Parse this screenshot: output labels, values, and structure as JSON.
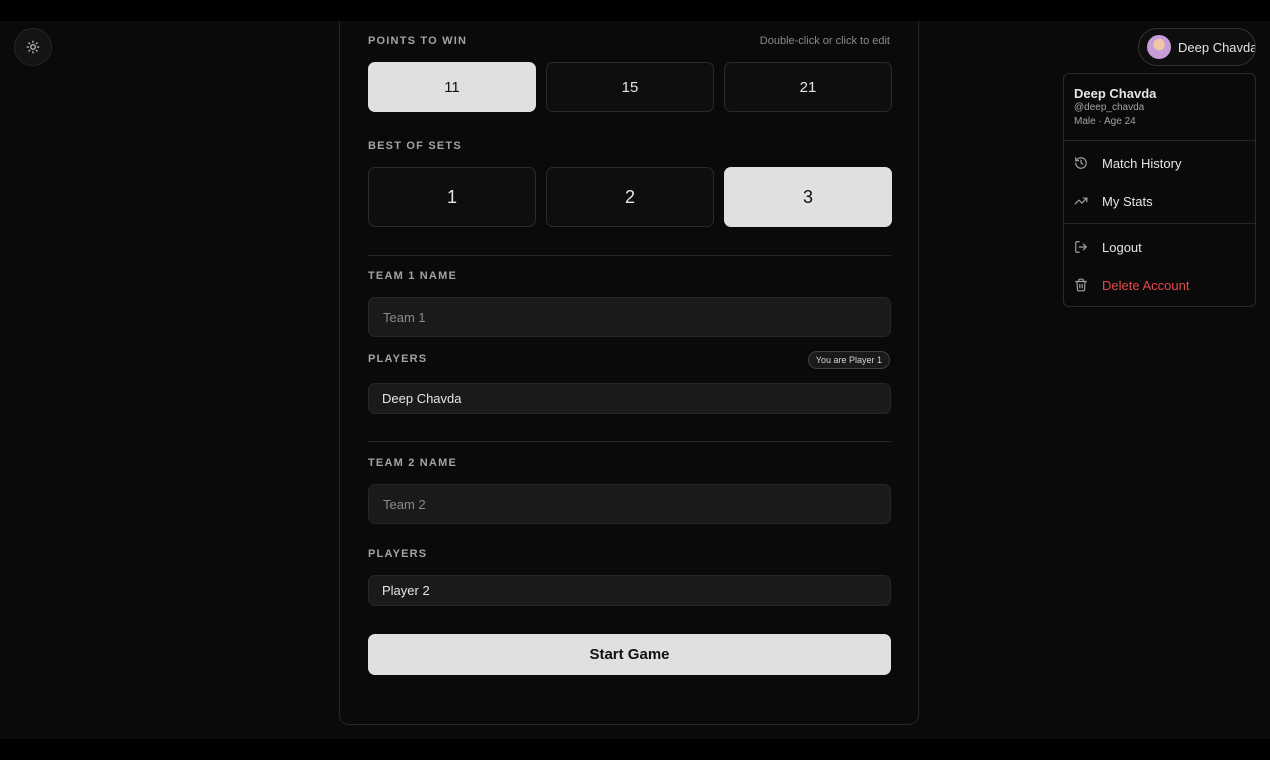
{
  "points": {
    "label": "POINTS TO WIN",
    "hint": "Double-click or click to edit",
    "options": [
      "11",
      "15",
      "21"
    ],
    "selected": "11"
  },
  "sets": {
    "label": "BEST OF SETS",
    "options": [
      "1",
      "2",
      "3"
    ],
    "selected": "3"
  },
  "team1": {
    "name_label": "TEAM 1 NAME",
    "name_placeholder": "Team 1",
    "players_label": "PLAYERS",
    "player_badge": "You are Player 1",
    "player_value": "Deep Chavda"
  },
  "team2": {
    "name_label": "TEAM 2 NAME",
    "name_placeholder": "Team 2",
    "players_label": "PLAYERS",
    "player_value": "Player 2"
  },
  "start_label": "Start Game",
  "user": {
    "button_name": "Deep Chavda",
    "name": "Deep Chavda",
    "handle": "@deep_chavda",
    "meta": "Male · Age 24"
  },
  "menu": {
    "items": [
      "Match History",
      "My Stats",
      "Logout",
      "Delete Account"
    ]
  },
  "colors": {
    "background": "#0a0a0a",
    "selected": "#e0e0e0",
    "danger": "#e5484d"
  },
  "icons": [
    "sun-icon",
    "history-icon",
    "trending-up-icon",
    "logout-icon",
    "trash-icon"
  ]
}
